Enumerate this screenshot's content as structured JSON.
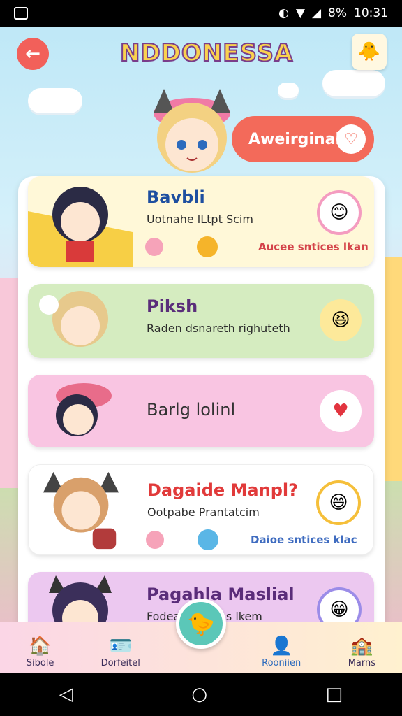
{
  "status_bar": {
    "battery": "8%",
    "time": "10:31"
  },
  "header": {
    "title": "NDDONESSA",
    "back_label": "←"
  },
  "hero": {
    "pill_label": "Aweirginal"
  },
  "cards": [
    {
      "name": "Bavbli",
      "subtitle": "Uotnahe lLtpt Scim",
      "meta": "Aucee sntices lkan",
      "name_color": "#1e4fa0",
      "bg": "#fff8d8",
      "av_bg": "#f7cf45"
    },
    {
      "name": "Piksh",
      "subtitle": "Raden dsnareth righuteth",
      "meta": "",
      "name_color": "#5a2d7a",
      "bg": "#d5ecc0",
      "av_bg": "#d5ecc0"
    },
    {
      "name": "Barlg lolinl",
      "subtitle": "",
      "meta": "",
      "name_color": "#333",
      "bg": "#f9c5e2",
      "av_bg": "#f9c5e2"
    },
    {
      "name": "Dagaide Manpl?",
      "subtitle": "Ootpabe Prantatcim",
      "meta": "Daioe sntices klac",
      "name_color": "#e13a3a",
      "bg": "#ffffff",
      "av_bg": "#ffffff"
    },
    {
      "name": "Pagahla Maslial",
      "subtitle": "Fodeatle hlems lkem",
      "meta": "",
      "name_color": "#5a2d7a",
      "bg": "#ecc8f0",
      "av_bg": "#ecc8f0"
    }
  ],
  "bottom_nav": [
    {
      "label": "Sibole"
    },
    {
      "label": "Dorfeitel"
    },
    {
      "label": "Rooniien"
    },
    {
      "label": "Marns"
    }
  ]
}
